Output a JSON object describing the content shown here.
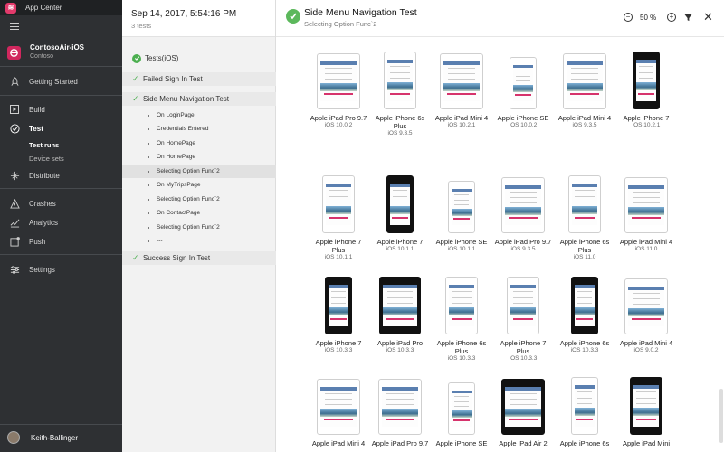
{
  "app": {
    "title": "App Center",
    "logo_text": "≋"
  },
  "org": {
    "name": "ContosoAir-iOS",
    "subtitle": "Contoso"
  },
  "nav": {
    "items": [
      {
        "label": "Getting Started",
        "icon": "rocket-icon"
      },
      {
        "label": "Build",
        "icon": "play-icon"
      },
      {
        "label": "Test",
        "icon": "check-circle-icon"
      },
      {
        "label": "Distribute",
        "icon": "distribute-icon"
      },
      {
        "label": "Crashes",
        "icon": "warning-icon"
      },
      {
        "label": "Analytics",
        "icon": "chart-icon"
      },
      {
        "label": "Push",
        "icon": "push-icon"
      },
      {
        "label": "Settings",
        "icon": "sliders-icon"
      }
    ],
    "test_subitems": [
      "Test runs",
      "Device sets"
    ],
    "user": "Keith-Ballinger"
  },
  "run": {
    "date": "Sep 14, 2017, 5:54:16 PM",
    "count": "3 tests"
  },
  "tree": {
    "root": "Tests(iOS)",
    "tests": [
      "Failed Sign In Test",
      "Side Menu Navigation Test",
      "Success Sign In Test"
    ],
    "steps": [
      "On LoginPage",
      "Credentials Entered",
      "On HomePage",
      "On HomePage",
      "Selecting Option Func`2",
      "On MyTripsPage",
      "Selecting Option Func`2",
      "On ContactPage",
      "Selecting Option Func`2",
      "---"
    ]
  },
  "header": {
    "title": "Side Menu Navigation Test",
    "subtitle": "Selecting Option Func`2",
    "zoom": "50 %"
  },
  "colors": {
    "accent": "#e23a6b",
    "pass": "#5cb85c",
    "nav_bg": "#2e3033"
  },
  "devices": [
    {
      "name": "Apple iPad Pro 9.7",
      "os": "iOS 10.0.2",
      "kind": "ipad",
      "dark": false
    },
    {
      "name": "Apple iPhone 6s Plus",
      "os": "iOS 9.3.5",
      "kind": "iphone-plus",
      "dark": false
    },
    {
      "name": "Apple iPad Mini 4",
      "os": "iOS 10.2.1",
      "kind": "ipad",
      "dark": false
    },
    {
      "name": "Apple iPhone SE",
      "os": "iOS 10.0.2",
      "kind": "iphone-se",
      "dark": false
    },
    {
      "name": "Apple iPad Mini 4",
      "os": "iOS 9.3.5",
      "kind": "ipad",
      "dark": false
    },
    {
      "name": "Apple iPhone 7",
      "os": "iOS 10.2.1",
      "kind": "iphone",
      "dark": true
    },
    {
      "name": "Apple iPhone 7 Plus",
      "os": "iOS 10.1.1",
      "kind": "iphone-plus",
      "dark": false
    },
    {
      "name": "Apple iPhone 7",
      "os": "iOS 10.1.1",
      "kind": "iphone",
      "dark": true
    },
    {
      "name": "Apple iPhone SE",
      "os": "iOS 10.1.1",
      "kind": "iphone-se",
      "dark": false
    },
    {
      "name": "Apple iPad Pro 9.7",
      "os": "iOS 9.3.5",
      "kind": "ipad",
      "dark": false
    },
    {
      "name": "Apple iPhone 6s Plus",
      "os": "iOS 11.0",
      "kind": "iphone-plus",
      "dark": false
    },
    {
      "name": "Apple iPad Mini 4",
      "os": "iOS 11.0",
      "kind": "ipad",
      "dark": false
    },
    {
      "name": "Apple iPhone 7",
      "os": "iOS 10.3.3",
      "kind": "iphone",
      "dark": true
    },
    {
      "name": "Apple iPad Pro",
      "os": "iOS 10.3.3",
      "kind": "ipad-pro",
      "dark": true
    },
    {
      "name": "Apple iPhone 6s Plus",
      "os": "iOS 10.3.3",
      "kind": "iphone-plus",
      "dark": false
    },
    {
      "name": "Apple iPhone 7 Plus",
      "os": "iOS 10.3.3",
      "kind": "iphone-plus",
      "dark": false
    },
    {
      "name": "Apple iPhone 6s",
      "os": "iOS 10.3.3",
      "kind": "iphone",
      "dark": true
    },
    {
      "name": "Apple iPad Mini 4",
      "os": "iOS 9.0.2",
      "kind": "ipad",
      "dark": false
    },
    {
      "name": "Apple iPad Mini 4",
      "os": "",
      "kind": "ipad",
      "dark": false
    },
    {
      "name": "Apple iPad Pro 9.7",
      "os": "",
      "kind": "ipad",
      "dark": false
    },
    {
      "name": "Apple iPhone SE",
      "os": "",
      "kind": "iphone-se",
      "dark": false
    },
    {
      "name": "Apple iPad Air 2",
      "os": "",
      "kind": "ipad",
      "dark": true
    },
    {
      "name": "Apple iPhone 6s",
      "os": "",
      "kind": "iphone",
      "dark": false
    },
    {
      "name": "Apple iPad Mini",
      "os": "",
      "kind": "ipad-mini",
      "dark": true
    }
  ]
}
